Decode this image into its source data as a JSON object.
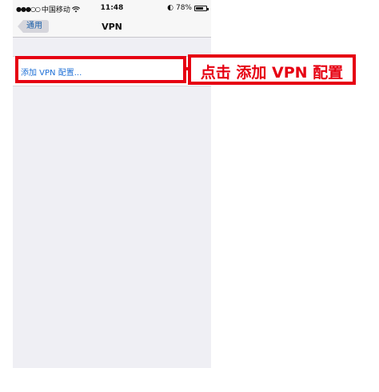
{
  "status_bar": {
    "carrier": "中国移动",
    "signal_dots": "●●●○○",
    "wifi_icon": "wifi-icon",
    "time": "11:48",
    "battery_percent": "78%",
    "battery_level": 0.78,
    "lock_icon": "◐"
  },
  "nav": {
    "back_label": "通用",
    "title": "VPN"
  },
  "vpn_list": {
    "add_label": "添加 VPN 配置..."
  },
  "annotation": {
    "callout": "点击 添加 VPN 配置",
    "color": "#e60012"
  },
  "colors": {
    "link_blue": "#1e6fd6",
    "background": "#efeff4"
  }
}
